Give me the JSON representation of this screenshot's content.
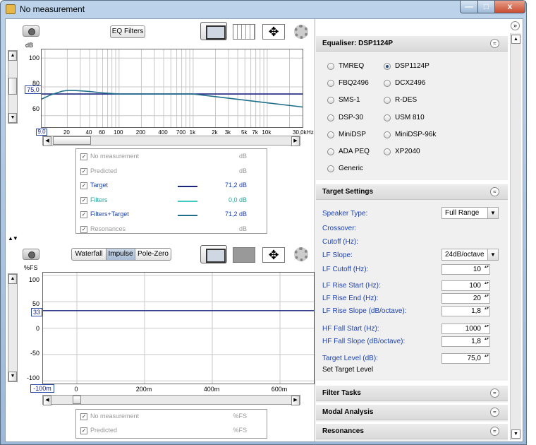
{
  "window": {
    "title": "No measurement",
    "minimize": "—",
    "maximize": "□",
    "close": "x"
  },
  "graph1": {
    "eq_filters_label": "EQ Filters",
    "unit": "dB",
    "y_ticks": [
      "100",
      "80",
      "60"
    ],
    "y_field": "75,0",
    "x_start": "9,0",
    "x_ticks": [
      "20",
      "40",
      "60",
      "100",
      "200",
      "400",
      "700",
      "1k",
      "2k",
      "3k",
      "5k",
      "7k",
      "10k",
      "30,0k"
    ],
    "x_unit": "Hz",
    "legend": [
      {
        "label": "No measurement",
        "value": "dB",
        "checked": true,
        "enabled": false,
        "color": ""
      },
      {
        "label": "Predicted",
        "value": "dB",
        "checked": true,
        "enabled": false,
        "color": ""
      },
      {
        "label": "Target",
        "value": "71,2 dB",
        "checked": true,
        "enabled": true,
        "color": "#1a237e"
      },
      {
        "label": "Filters",
        "value": "0,0 dB",
        "checked": true,
        "enabled": true,
        "color": "#3fc9c0"
      },
      {
        "label": "Filters+Target",
        "value": "71,2 dB",
        "checked": true,
        "enabled": true,
        "color": "#1f6f8b"
      },
      {
        "label": "Resonances",
        "value": "dB",
        "checked": true,
        "enabled": false,
        "color": ""
      }
    ],
    "chart_data": {
      "type": "line",
      "x_scale": "log",
      "xlim": [
        9,
        30000
      ],
      "ylim": [
        52,
        106
      ],
      "series": [
        {
          "name": "Target",
          "x": [
            9,
            15,
            20,
            30,
            100,
            1000,
            2000,
            30000
          ],
          "y": [
            75,
            75,
            75,
            75,
            75,
            75,
            75,
            75
          ]
        },
        {
          "name": "Filters+Target",
          "x": [
            9,
            12,
            17,
            20,
            25,
            40,
            60,
            100,
            1000,
            30000
          ],
          "y": [
            71.5,
            74.5,
            77,
            77.5,
            77.5,
            76.8,
            75.8,
            75,
            75,
            66
          ]
        }
      ]
    }
  },
  "divider": "▲▼",
  "graph2": {
    "tabs": [
      "Waterfall",
      "Impulse",
      "Pole-Zero"
    ],
    "active_tab": "Impulse",
    "unit": "%FS",
    "y_ticks": [
      "100",
      "50",
      "0",
      "-50",
      "-100"
    ],
    "y_field": "33",
    "x_start": "-100m",
    "x_ticks": [
      "0",
      "200m",
      "400m",
      "600m"
    ],
    "legend": [
      {
        "label": "No measurement",
        "value": "%FS",
        "checked": true,
        "enabled": false
      },
      {
        "label": "Predicted",
        "value": "%FS",
        "checked": true,
        "enabled": false
      }
    ],
    "chart_data": {
      "type": "line",
      "xlim": [
        -100,
        700
      ],
      "ylim": [
        -105,
        105
      ],
      "series": [
        {
          "name": "",
          "x": [
            -100,
            700
          ],
          "y": [
            33,
            33
          ]
        }
      ]
    }
  },
  "collapse_label": "»",
  "equaliser": {
    "title": "Equaliser: DSP1124P",
    "chevron": "≈",
    "options": [
      {
        "label": "TMREQ",
        "selected": false
      },
      {
        "label": "DSP1124P",
        "selected": true
      },
      {
        "label": "FBQ2496",
        "selected": false
      },
      {
        "label": "DCX2496",
        "selected": false
      },
      {
        "label": "SMS-1",
        "selected": false
      },
      {
        "label": "R-DES",
        "selected": false
      },
      {
        "label": "DSP-30",
        "selected": false
      },
      {
        "label": "USM 810",
        "selected": false
      },
      {
        "label": "MiniDSP",
        "selected": false
      },
      {
        "label": "MiniDSP-96k",
        "selected": false
      },
      {
        "label": "ADA PEQ",
        "selected": false
      },
      {
        "label": "XP2040",
        "selected": false
      },
      {
        "label": "Generic",
        "selected": false
      }
    ]
  },
  "target": {
    "title": "Target Settings",
    "chevron": "≈",
    "speaker_type_label": "Speaker Type:",
    "speaker_type_value": "Full Range",
    "crossover_label": "Crossover:",
    "cutoff_label": "Cutoff (Hz):",
    "lf_slope_label": "LF Slope:",
    "lf_slope_value": "24dB/octave",
    "lf_cutoff_label": "LF Cutoff (Hz):",
    "lf_cutoff_value": "10",
    "lf_rise_start_label": "LF Rise Start (Hz):",
    "lf_rise_start_value": "100",
    "lf_rise_end_label": "LF Rise End (Hz):",
    "lf_rise_end_value": "20",
    "lf_rise_slope_label": "LF Rise Slope (dB/octave):",
    "lf_rise_slope_value": "1,8",
    "hf_fall_start_label": "HF Fall Start (Hz):",
    "hf_fall_start_value": "1000",
    "hf_fall_slope_label": "HF Fall Slope (dB/octave):",
    "hf_fall_slope_value": "1,8",
    "target_level_label": "Target Level (dB):",
    "target_level_value": "75,0",
    "set_target_level": "Set Target Level"
  },
  "collapsed_panels": [
    {
      "title": "Filter Tasks",
      "chevron": "≈"
    },
    {
      "title": "Modal Analysis",
      "chevron": "≈"
    },
    {
      "title": "Resonances",
      "chevron": "≈"
    }
  ]
}
